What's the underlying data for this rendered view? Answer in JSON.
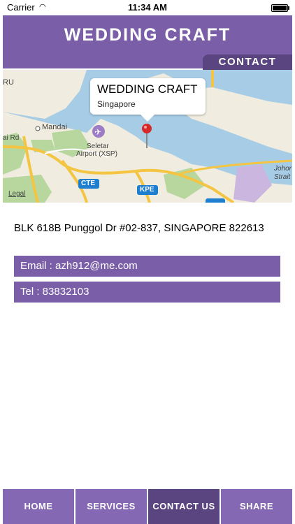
{
  "status_bar": {
    "carrier": "Carrier",
    "time": "11:34 AM"
  },
  "header": {
    "title": "WEDDING CRAFT",
    "section_tab": "CONTACT"
  },
  "map": {
    "callout": {
      "title": "WEDDING CRAFT",
      "subtitle": "Singapore"
    },
    "labels": {
      "mandai": "Mandai",
      "seletar": "Seletar",
      "airport": "Airport (XSP)",
      "cte": "CTE",
      "kpe": "KPE",
      "legal": "Legal",
      "johor": "Johor",
      "strait": "Strait",
      "ru": "RU",
      "ai_rd": "ai Rd"
    },
    "colors": {
      "water": "#a7cde6",
      "land": "#f0ece0",
      "park": "#b7d79e",
      "road": "#f4c542",
      "pin": "#d62a2a"
    }
  },
  "contact": {
    "address": "BLK 618B Punggol Dr #02-837, SINGAPORE 822613",
    "email": "Email : azh912@me.com",
    "tel": "Tel : 83832103"
  },
  "nav": [
    {
      "label": "HOME"
    },
    {
      "label": "SERVICES"
    },
    {
      "label": "CONTACT US"
    },
    {
      "label": "SHARE"
    }
  ],
  "colors": {
    "brand": "#7a5fa8",
    "brand_dark": "#5a4580",
    "nav": "#8468b4"
  }
}
